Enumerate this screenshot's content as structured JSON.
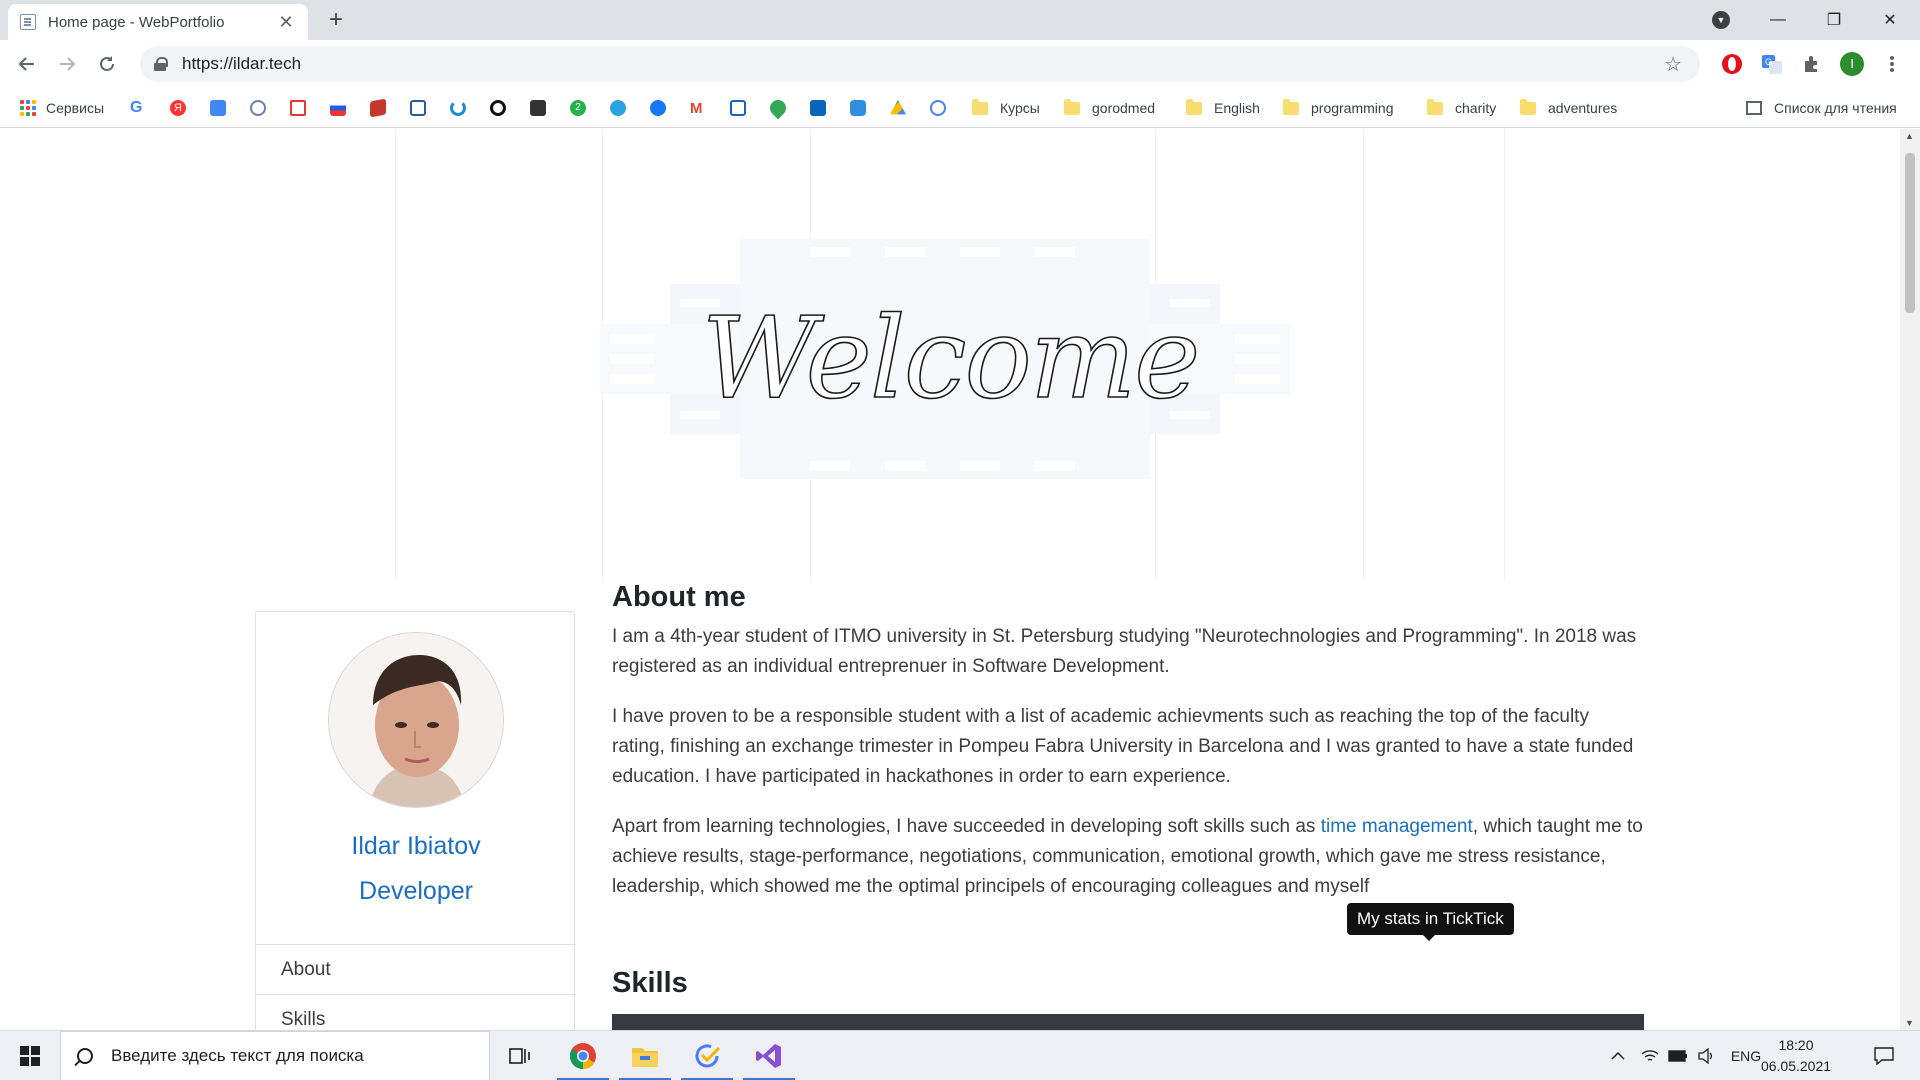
{
  "browser": {
    "tab_title": "Home page - WebPortfolio",
    "tab_close": "✕",
    "new_tab": "+",
    "url": "https://ildar.tech",
    "window_controls": {
      "minimize": "—",
      "restore": "❐",
      "close": "✕"
    }
  },
  "bookmarks": {
    "apps_label": "Сервисы",
    "folders": [
      "Курсы",
      "gorodmed",
      "English",
      "programming",
      "charity",
      "adventures"
    ],
    "reading_list": "Список для чтения"
  },
  "hero": {
    "welcome": "Welcome"
  },
  "profile": {
    "name": "Ildar Ibiatov",
    "role": "Developer",
    "nav": [
      "About",
      "Skills"
    ]
  },
  "about": {
    "title": "About me",
    "p1": "I am a 4th-year student of ITMO university in St. Petersburg studying \"Neurotechnologies and Programming\". In 2018 was registered as an individual entreprenuer in Software Development.",
    "p2": "I have proven to be a responsible student with a list of academic achievments such as reaching the top of the faculty rating, finishing an exchange trimester in Pompeu Fabra University in Barcelona and I was granted to have a state funded education. I have participated in hackathones in order to earn experience.",
    "p3_before": "Apart from learning technologies, I have succeeded in developing soft skills such as ",
    "p3_link": "time management",
    "p3_after": ", which taught me to achieve results, stage-performance, negotiations, communication, emotional growth, which gave me stress resistance, leadership, which showed me the optimal principels of encouraging colleagues and myself",
    "tooltip": "My stats in TickTick"
  },
  "skills": {
    "title": "Skills"
  },
  "taskbar": {
    "search_placeholder": "Введите здесь текст для поиска",
    "language": "ENG",
    "time": "18:20",
    "date": "06.05.2021"
  },
  "colors": {
    "link": "#1a6fc4",
    "taskbar_accent": "#3b78d4",
    "skills_bar": "#343a40"
  }
}
